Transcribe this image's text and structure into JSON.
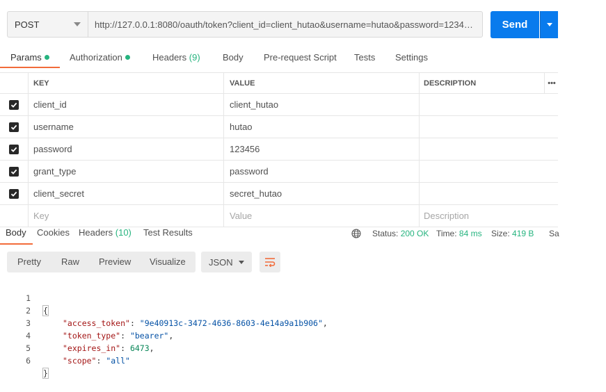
{
  "request": {
    "method": "POST",
    "url": "http://127.0.0.1:8080/oauth/token?client_id=client_hutao&username=hutao&password=123456&...",
    "send_label": "Send"
  },
  "request_tabs": [
    {
      "label": "Params",
      "indicator": "dot"
    },
    {
      "label": "Authorization",
      "indicator": "dot"
    },
    {
      "label": "Headers",
      "count": "(9)"
    },
    {
      "label": "Body"
    },
    {
      "label": "Pre-request Script"
    },
    {
      "label": "Tests"
    },
    {
      "label": "Settings"
    }
  ],
  "params": {
    "headers": {
      "key": "KEY",
      "value": "VALUE",
      "description": "DESCRIPTION",
      "more": "•••"
    },
    "rows": [
      {
        "key": "client_id",
        "value": "client_hutao",
        "checked": true
      },
      {
        "key": "username",
        "value": "hutao",
        "checked": true
      },
      {
        "key": "password",
        "value": "123456",
        "checked": true
      },
      {
        "key": "grant_type",
        "value": "password",
        "checked": true
      },
      {
        "key": "client_secret",
        "value": "secret_hutao",
        "checked": true
      }
    ],
    "placeholder": {
      "key": "Key",
      "value": "Value",
      "description": "Description"
    }
  },
  "response_tabs": [
    {
      "label": "Body"
    },
    {
      "label": "Cookies"
    },
    {
      "label": "Headers",
      "count": "(10)"
    },
    {
      "label": "Test Results"
    }
  ],
  "response_status": {
    "status_label": "Status:",
    "status_value": "200 OK",
    "time_label": "Time:",
    "time_value": "84 ms",
    "size_label": "Size:",
    "size_value": "419 B",
    "save_label": "Sa"
  },
  "format_bar": {
    "buttons": [
      "Pretty",
      "Raw",
      "Preview",
      "Visualize"
    ],
    "selected_format": "JSON"
  },
  "response_body": {
    "line_numbers": [
      "1",
      "2",
      "3",
      "4",
      "5",
      "6"
    ],
    "open_brace": "{",
    "close_brace": "}",
    "fields": [
      {
        "key": "\"access_token\"",
        "value": "\"9e40913c-3472-4636-8603-4e14a9a1b906\"",
        "type": "string",
        "comma": ","
      },
      {
        "key": "\"token_type\"",
        "value": "\"bearer\"",
        "type": "string",
        "comma": ","
      },
      {
        "key": "\"expires_in\"",
        "value": "6473",
        "type": "number",
        "comma": ","
      },
      {
        "key": "\"scope\"",
        "value": "\"all\"",
        "type": "string",
        "comma": ""
      }
    ]
  },
  "colors": {
    "accent_blue": "#097bed",
    "active_tab_underline": "#f26b3a",
    "status_green": "#26b47f"
  }
}
